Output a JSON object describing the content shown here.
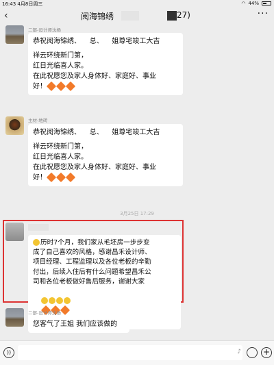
{
  "status_bar": {
    "time": "16:43",
    "date": "4月8日周三",
    "wifi": "wifi-icon",
    "battery_percent": "44%"
  },
  "nav": {
    "back_icon": "chevron-left-icon",
    "title": "阅海锦绣",
    "member_count": "27)",
    "more_icon": "more-icon"
  },
  "messages": [
    {
      "sender": "二部-设计师沈杨",
      "lines": [
        "恭祝阅海锦绣、    总、    姐尊宅竣工大吉",
        "",
        "祥云环绕新门第，",
        "红日光临喜人家。",
        "在此祝愿您及家人身体好、家庭好、事业",
        "好！"
      ]
    },
    {
      "sender": "主材-地砖",
      "lines": [
        "恭祝阅海锦绣、    总、    姐尊宅竣工大吉",
        "",
        "祥云环绕新门第，",
        "红日光临喜人家。",
        "在此祝愿您及家人身体好、家庭好、事业",
        "好！"
      ]
    },
    {
      "sender": "",
      "lines": [
        "历时7个月，我们家从毛坯房一步步变",
        "成了自己喜欢的风格，感谢昌禾设计师、",
        "项目经理、工程监理以及各位老板的辛勤",
        "付出，后续入住后有什么问题希望昌禾公",
        "司和各位老板做好售后服务，谢谢大家"
      ]
    },
    {
      "sender": "二部-设计师沈杨",
      "lines": [
        "您客气了王姐 我们应该做的"
      ]
    }
  ],
  "timestamp": "3月25日 17:29",
  "input_bar": {
    "voice_icon": "voice-icon",
    "mic_icon": "mic-icon",
    "emoji_icon": "emoji-icon",
    "plus_icon": "plus-icon"
  }
}
